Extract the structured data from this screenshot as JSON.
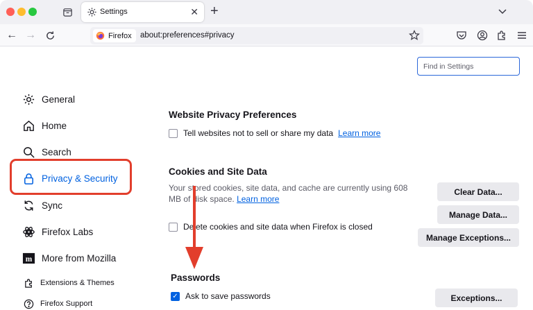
{
  "tab": {
    "title": "Settings"
  },
  "url": {
    "identity_label": "Firefox",
    "address": "about:preferences#privacy"
  },
  "search": {
    "placeholder": "Find in Settings"
  },
  "sidebar": {
    "items": [
      {
        "label": "General",
        "icon": "gear-icon"
      },
      {
        "label": "Home",
        "icon": "home-icon"
      },
      {
        "label": "Search",
        "icon": "search-icon"
      },
      {
        "label": "Privacy & Security",
        "icon": "lock-icon",
        "selected": true
      },
      {
        "label": "Sync",
        "icon": "sync-icon"
      },
      {
        "label": "Firefox Labs",
        "icon": "labs-icon"
      },
      {
        "label": "More from Mozilla",
        "icon": "mozilla-icon"
      },
      {
        "label": "Extensions & Themes",
        "icon": "puzzle-icon"
      },
      {
        "label": "Firefox Support",
        "icon": "help-icon"
      }
    ]
  },
  "privacy_prefs": {
    "title": "Website Privacy Preferences",
    "checkbox_label": "Tell websites not to sell or share my data",
    "learn_more": "Learn more"
  },
  "cookies": {
    "title": "Cookies and Site Data",
    "desc_before": "Your stored cookies, site data, and cache are currently using 608 MB of disk space.",
    "learn_more": "Learn more",
    "checkbox_label": "Delete cookies and site data when Firefox is closed",
    "clear_button": "Clear Data...",
    "manage_button": "Manage Data...",
    "exceptions_button": "Manage Exceptions..."
  },
  "passwords": {
    "title": "Passwords",
    "checkbox_label": "Ask to save passwords",
    "exceptions_button": "Exceptions..."
  },
  "colors": {
    "accent": "#0061e0",
    "annotation": "#e23e2c"
  }
}
